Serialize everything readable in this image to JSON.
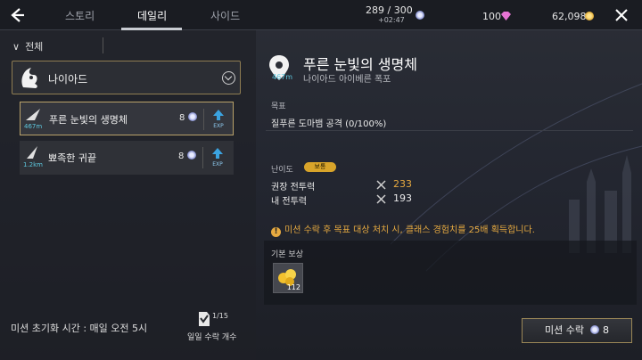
{
  "header": {
    "tabs": [
      {
        "label": "스토리"
      },
      {
        "label": "데일리"
      },
      {
        "label": "사이드"
      }
    ],
    "energy": {
      "value": "289 / 300",
      "sub": "+02:47"
    },
    "gems": {
      "value": "100"
    },
    "gold": {
      "value": "62,098"
    }
  },
  "sidebar": {
    "section_title": "전체",
    "region": {
      "name": "나이아드"
    },
    "missions": [
      {
        "name": "푸른 눈빛의 생명체",
        "distance": "467m",
        "cost": "8"
      },
      {
        "name": "뾰족한 귀끝",
        "distance": "1.2km",
        "cost": "8"
      }
    ],
    "exp_label": "EXP",
    "reset_text": "미션 초기화 시간 : 매일 오전 5시",
    "daily": {
      "count": "1/15",
      "label": "일일 수락 개수"
    }
  },
  "detail": {
    "title": "푸른 눈빛의 생명체",
    "distance": "467m",
    "subtitle": "나이아드 아이베른 폭포",
    "goal_label": "목표",
    "goal_text": "질푸른 도마뱀 공격 (0/100%)",
    "difficulty_label": "난이도",
    "difficulty_badge": "보통",
    "recommended_label": "권장 전투력",
    "recommended_value": "233",
    "my_power_label": "내 전투력",
    "my_power_value": "193",
    "notice": "미션 수락 후 목표 대상 처치 시, 클래스 경험치를 25배 획득합니다.",
    "reward_label": "기본 보상",
    "reward_count": "112",
    "accept_label": "미션 수락",
    "accept_cost": "8"
  },
  "colors": {
    "accent_gold": "#b9a26a",
    "warn_orange": "#e6a940",
    "distance_cyan": "#5ec9e0"
  }
}
